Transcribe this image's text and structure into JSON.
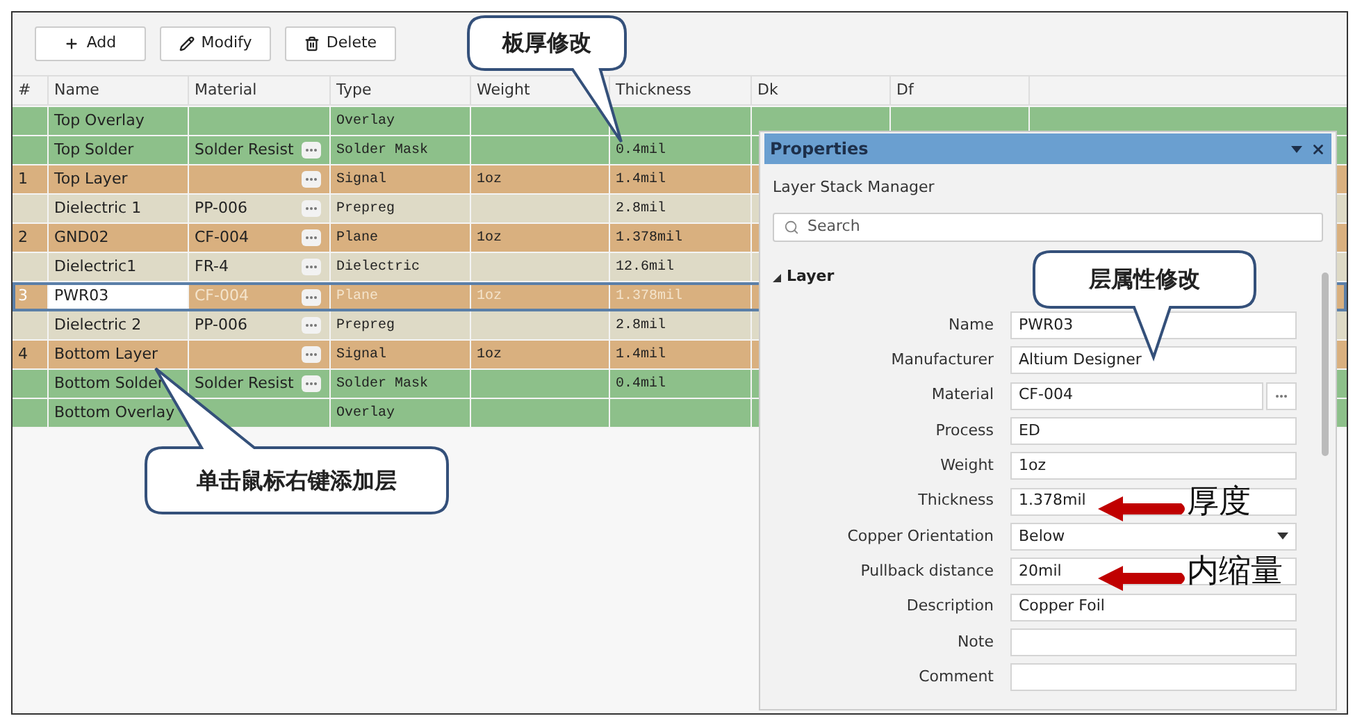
{
  "toolbar": [
    {
      "label": "Add",
      "kind": "add"
    },
    {
      "label": "Modify",
      "kind": "modify"
    },
    {
      "label": "Delete",
      "kind": "delete"
    }
  ],
  "columns": [
    "#",
    "Name",
    "Material",
    "Type",
    "Weight",
    "Thickness",
    "Dk",
    "Df"
  ],
  "rows": [
    {
      "name": "Top Overlay",
      "type": "Overlay",
      "kind": "mask",
      "picker": false,
      "selected": false
    },
    {
      "name": "Top Solder",
      "material": "Solder Resist",
      "type": "Solder Mask",
      "thickness": "0.4mil",
      "kind": "mask",
      "picker": true,
      "selected": false
    },
    {
      "index": "1",
      "name": "Top Layer",
      "type": "Signal",
      "weight": "1oz",
      "thickness": "1.4mil",
      "kind": "copper",
      "picker": true,
      "selected": false
    },
    {
      "name": "Dielectric 1",
      "material": "PP-006",
      "type": "Prepreg",
      "thickness": "2.8mil",
      "kind": "dielectric",
      "picker": true,
      "selected": false
    },
    {
      "index": "2",
      "name": "GND02",
      "material": "CF-004",
      "type": "Plane",
      "weight": "1oz",
      "thickness": "1.378mil",
      "kind": "copper",
      "picker": true,
      "selected": false
    },
    {
      "name": "Dielectric1",
      "material": "FR-4",
      "type": "Dielectric",
      "thickness": "12.6mil",
      "kind": "dielectric",
      "picker": true,
      "selected": false
    },
    {
      "index": "3",
      "name": "PWR03",
      "material": "CF-004",
      "type": "Plane",
      "weight": "1oz",
      "thickness": "1.378mil",
      "kind": "copper",
      "picker": true,
      "selected": true
    },
    {
      "name": "Dielectric 2",
      "material": "PP-006",
      "type": "Prepreg",
      "thickness": "2.8mil",
      "kind": "dielectric",
      "picker": true,
      "selected": false
    },
    {
      "index": "4",
      "name": "Bottom Layer",
      "type": "Signal",
      "weight": "1oz",
      "thickness": "1.4mil",
      "kind": "copper",
      "picker": true,
      "selected": false
    },
    {
      "name": "Bottom Solder",
      "material": "Solder Resist",
      "type": "Solder Mask",
      "thickness": "0.4mil",
      "kind": "mask",
      "picker": true,
      "selected": false
    },
    {
      "name": "Bottom Overlay",
      "type": "Overlay",
      "kind": "mask",
      "picker": false,
      "selected": false
    }
  ],
  "properties": {
    "title": "Properties",
    "subtitle": "Layer Stack Manager",
    "search": {
      "placeholder": "Search"
    },
    "section": {
      "label": "Layer",
      "expanded": true
    },
    "fields": [
      {
        "label": "Name",
        "value": "PWR03",
        "kind": "text"
      },
      {
        "label": "Manufacturer",
        "value": "Altium Designer",
        "kind": "text"
      },
      {
        "label": "Material",
        "value": "CF-004",
        "kind": "picker"
      },
      {
        "label": "Process",
        "value": "ED",
        "kind": "text"
      },
      {
        "label": "Weight",
        "value": "1oz",
        "kind": "text"
      },
      {
        "label": "Thickness",
        "value": "1.378mil",
        "kind": "text",
        "note": "厚度"
      },
      {
        "label": "Copper Orientation",
        "value": "Below",
        "kind": "dropdown"
      },
      {
        "label": "Pullback distance",
        "value": "20mil",
        "kind": "text",
        "note": "内缩量"
      },
      {
        "label": "Description",
        "value": "Copper Foil",
        "kind": "text"
      },
      {
        "label": "Note",
        "kind": "text"
      },
      {
        "label": "Comment",
        "kind": "text"
      }
    ]
  },
  "callouts": [
    {
      "text": "板厚修改"
    },
    {
      "text": "层属性修改"
    },
    {
      "text": "单击鼠标右键添加层"
    }
  ]
}
